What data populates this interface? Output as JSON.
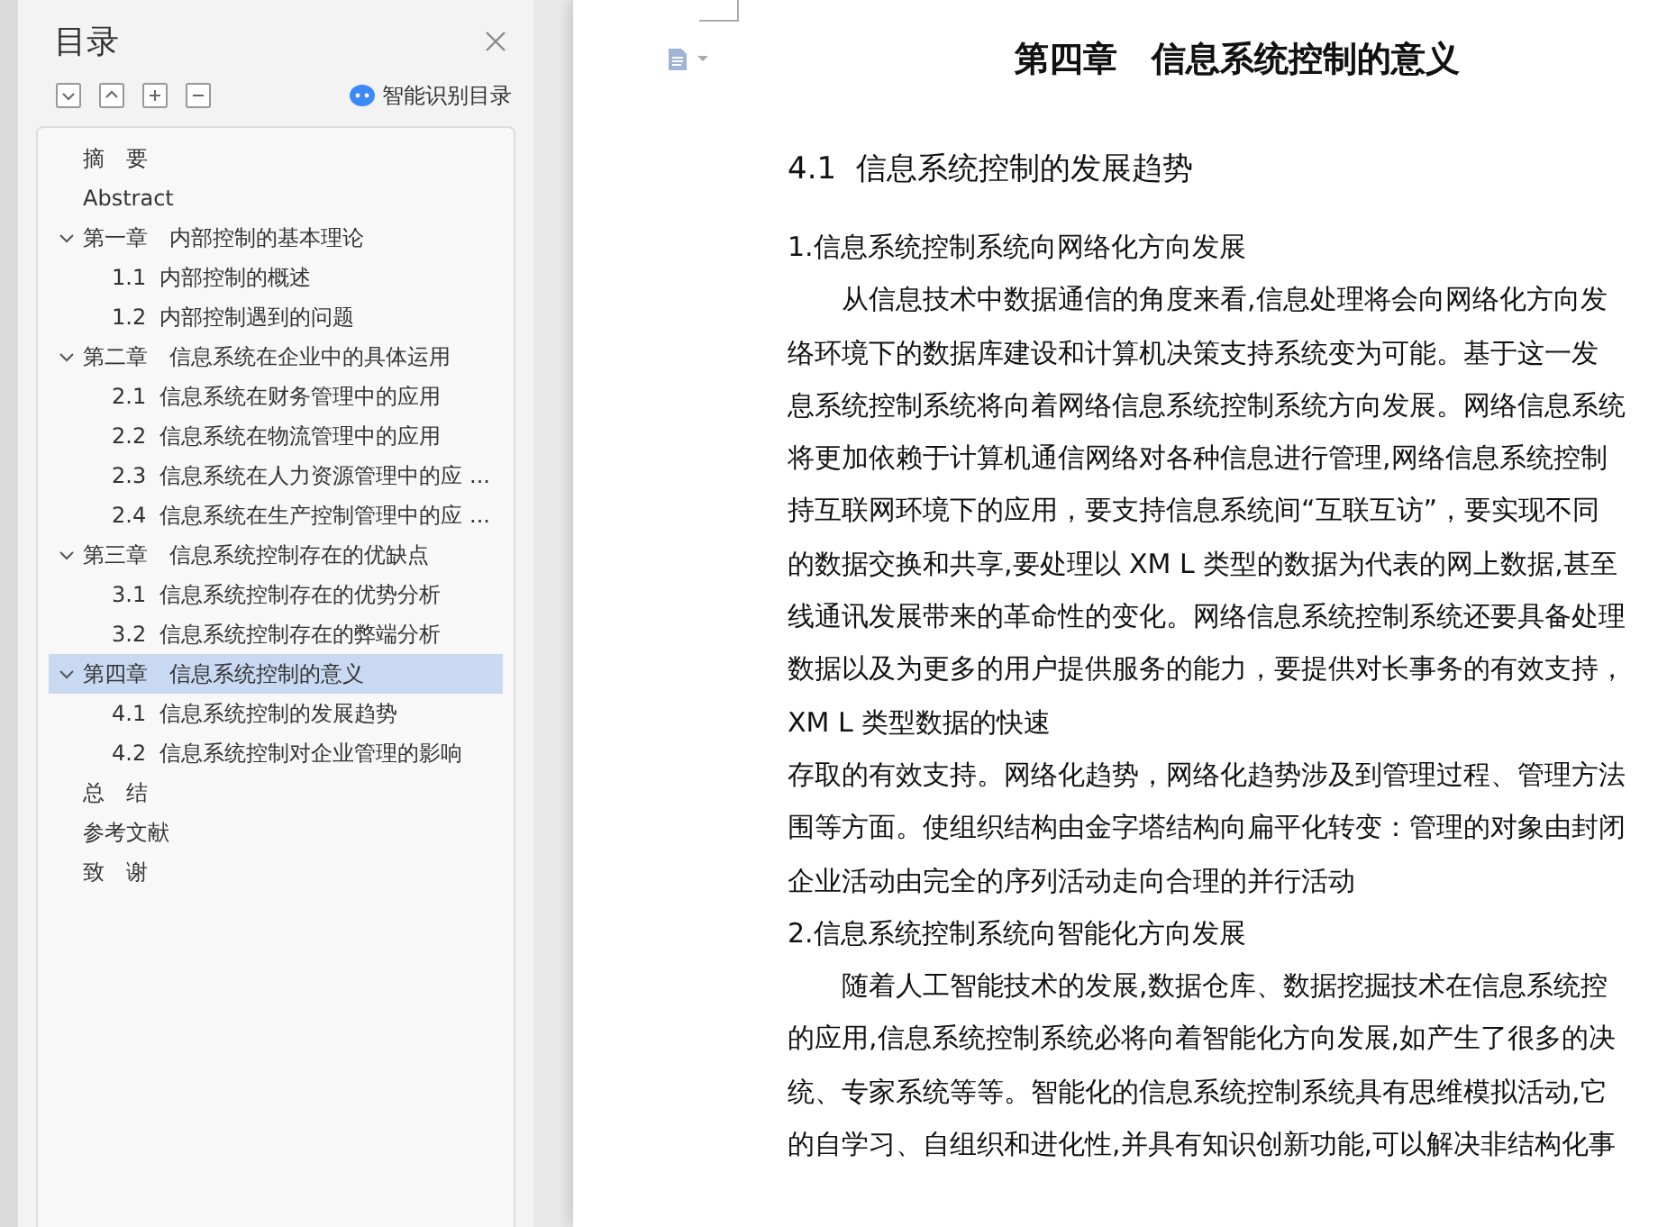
{
  "toc": {
    "title": "目录",
    "smart_label": "智能识别目录",
    "items": [
      {
        "label": "摘　要",
        "selected": false
      },
      {
        "label": "Abstract",
        "selected": false
      },
      {
        "label": "第一章　内部控制的基本理论",
        "selected": false,
        "expanded": true,
        "children": [
          {
            "label": "1.1  内部控制的概述",
            "selected": false
          },
          {
            "label": "1.2  内部控制遇到的问题",
            "selected": false
          }
        ]
      },
      {
        "label": "第二章　信息系统在企业中的具体运用",
        "selected": false,
        "expanded": true,
        "children": [
          {
            "label": "2.1  信息系统在财务管理中的应用",
            "selected": false
          },
          {
            "label": "2.2  信息系统在物流管理中的应用",
            "selected": false
          },
          {
            "label": "2.3  信息系统在人力资源管理中的应 ...",
            "selected": false
          },
          {
            "label": "2.4  信息系统在生产控制管理中的应 ...",
            "selected": false
          }
        ]
      },
      {
        "label": "第三章　信息系统控制存在的优缺点",
        "selected": false,
        "expanded": true,
        "children": [
          {
            "label": "3.1  信息系统控制存在的优势分析",
            "selected": false
          },
          {
            "label": "3.2  信息系统控制存在的弊端分析",
            "selected": false
          }
        ]
      },
      {
        "label": "第四章　信息系统控制的意义",
        "selected": true,
        "expanded": true,
        "children": [
          {
            "label": "4.1  信息系统控制的发展趋势",
            "selected": false
          },
          {
            "label": "4.2  信息系统控制对企业管理的影响",
            "selected": false
          }
        ]
      },
      {
        "label": "总　结",
        "selected": false
      },
      {
        "label": "参考文献",
        "selected": false
      },
      {
        "label": "致　谢",
        "selected": false
      }
    ]
  },
  "document": {
    "chapter_title": "第四章　信息系统控制的意义",
    "section_title": "4.1  信息系统控制的发展趋势",
    "lines": [
      {
        "kind": "heading",
        "text": "1.信息系统控制系统向网络化方向发展"
      },
      {
        "kind": "indent",
        "text": "从信息技术中数据通信的角度来看,信息处理将会向网络化方向发"
      },
      {
        "kind": "plain",
        "text": "络环境下的数据库建设和计算机决策支持系统变为可能。基于这一发"
      },
      {
        "kind": "plain",
        "text": "息系统控制系统将向着网络信息系统控制系统方向发展。网络信息系统"
      },
      {
        "kind": "plain",
        "text": "将更加依赖于计算机通信网络对各种信息进行管理,网络信息系统控制"
      },
      {
        "kind": "plain",
        "text": "持互联网环境下的应用，要支持信息系统间“互联互访”，要实现不同"
      },
      {
        "kind": "plain",
        "text": "的数据交换和共享,要处理以 XM L 类型的数据为代表的网上数据,甚至"
      },
      {
        "kind": "plain",
        "text": "线通讯发展带来的革命性的变化。网络信息系统控制系统还要具备处理"
      },
      {
        "kind": "plain",
        "text": "数据以及为更多的用户提供服务的能力，要提供对长事务的有效支持，"
      },
      {
        "kind": "plain",
        "text": "XM L 类型数据的快速"
      },
      {
        "kind": "plain",
        "text": "存取的有效支持。网络化趋势，网络化趋势涉及到管理过程、管理方法"
      },
      {
        "kind": "plain",
        "text": "围等方面。使组织结构由金字塔结构向扁平化转变：管理的对象由封闭"
      },
      {
        "kind": "plain",
        "text": "企业活动由完全的序列活动走向合理的并行活动"
      },
      {
        "kind": "heading",
        "text": "2.信息系统控制系统向智能化方向发展"
      },
      {
        "kind": "indent",
        "text": "随着人工智能技术的发展,数据仓库、数据挖掘技术在信息系统控"
      },
      {
        "kind": "plain",
        "text": "的应用,信息系统控制系统必将向着智能化方向发展,如产生了很多的决"
      },
      {
        "kind": "plain",
        "text": "统、专家系统等等。智能化的信息系统控制系统具有思维模拟活动,它"
      },
      {
        "kind": "plain",
        "text": "的自学习、自组织和进化性,并具有知识创新功能,可以解决非结构化事"
      }
    ]
  }
}
